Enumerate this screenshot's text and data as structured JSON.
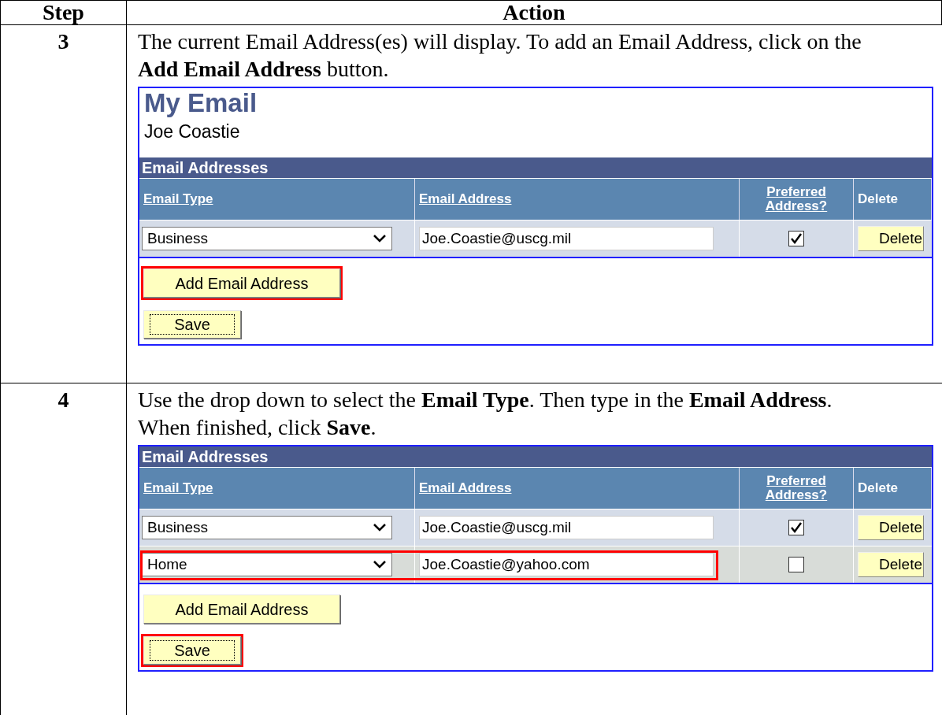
{
  "table": {
    "columns": [
      "Step",
      "Action"
    ],
    "steps": [
      {
        "number": "3",
        "instruction": "The current Email Address(es) will display. To add an Email Address, click on the **Add Email Address** button.",
        "screenshot": {
          "title": "My Email",
          "subtitle": "Joe Coastie",
          "grid_title": "Email Addresses",
          "columns": [
            "Email Type",
            "Email Address",
            "Preferred Address?",
            "Delete"
          ],
          "rows": [
            {
              "type": "Business",
              "address": "Joe.Coastie@uscg.mil",
              "preferred": true,
              "delete": "Delete",
              "highlighted": false
            }
          ],
          "add_button": {
            "label": "Add Email Address",
            "highlighted": true
          },
          "save_button": {
            "label": "Save",
            "highlighted": false
          }
        }
      },
      {
        "number": "4",
        "instruction": "Use the drop down to select the **Email Type**. Then type in the **Email Address**. When finished, click **Save**.",
        "screenshot": {
          "grid_title": "Email Addresses",
          "columns": [
            "Email Type",
            "Email Address",
            "Preferred Address?",
            "Delete"
          ],
          "rows": [
            {
              "type": "Business",
              "address": "Joe.Coastie@uscg.mil",
              "preferred": true,
              "delete": "Delete",
              "highlighted": false
            },
            {
              "type": "Home",
              "address": "Joe.Coastie@yahoo.com",
              "preferred": false,
              "delete": "Delete",
              "highlighted": true
            }
          ],
          "add_button": {
            "label": "Add Email Address",
            "highlighted": false
          },
          "save_button": {
            "label": "Save",
            "highlighted": true
          }
        }
      }
    ]
  }
}
